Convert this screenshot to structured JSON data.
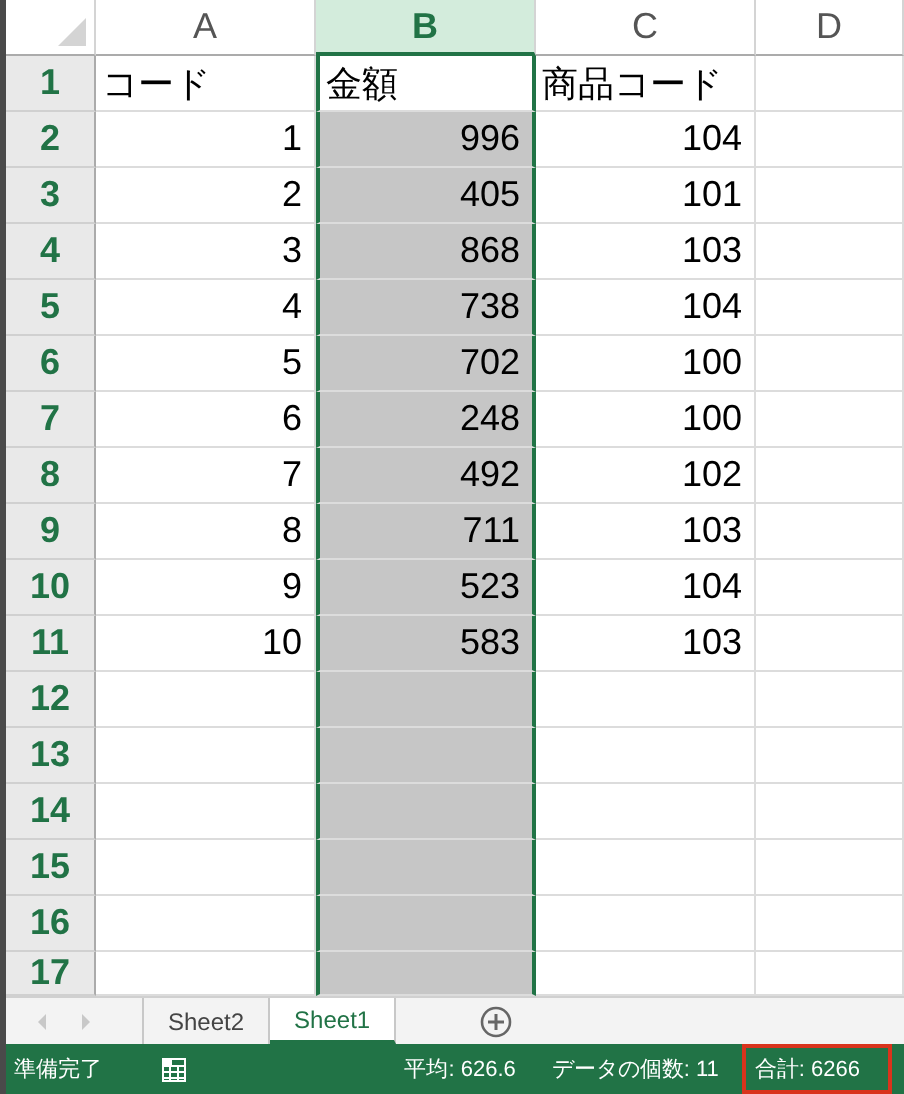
{
  "columns": [
    {
      "label": "A",
      "selected": false
    },
    {
      "label": "B",
      "selected": true
    },
    {
      "label": "C",
      "selected": false
    },
    {
      "label": "D",
      "selected": false
    }
  ],
  "rows": [
    {
      "header": "1",
      "cells": [
        "コード",
        "金額",
        "商品コード"
      ]
    },
    {
      "header": "2",
      "cells": [
        "1",
        "996",
        "104"
      ]
    },
    {
      "header": "3",
      "cells": [
        "2",
        "405",
        "101"
      ]
    },
    {
      "header": "4",
      "cells": [
        "3",
        "868",
        "103"
      ]
    },
    {
      "header": "5",
      "cells": [
        "4",
        "738",
        "104"
      ]
    },
    {
      "header": "6",
      "cells": [
        "5",
        "702",
        "100"
      ]
    },
    {
      "header": "7",
      "cells": [
        "6",
        "248",
        "100"
      ]
    },
    {
      "header": "8",
      "cells": [
        "7",
        "492",
        "102"
      ]
    },
    {
      "header": "9",
      "cells": [
        "8",
        "711",
        "103"
      ]
    },
    {
      "header": "10",
      "cells": [
        "9",
        "523",
        "104"
      ]
    },
    {
      "header": "11",
      "cells": [
        "10",
        "583",
        "103"
      ]
    },
    {
      "header": "12"
    },
    {
      "header": "13"
    },
    {
      "header": "14"
    },
    {
      "header": "15"
    },
    {
      "header": "16"
    },
    {
      "header": "17"
    }
  ],
  "sheet_tabs": [
    {
      "label": "Sheet2",
      "selected": false
    },
    {
      "label": "Sheet1",
      "selected": true
    }
  ],
  "status_bar": {
    "ready": "準備完了",
    "items": [
      {
        "text": "平均: 626.6",
        "highlighted": false
      },
      {
        "text": "データの個数: 11",
        "highlighted": false
      },
      {
        "text": "合計: 6266",
        "highlighted": true
      }
    ]
  }
}
